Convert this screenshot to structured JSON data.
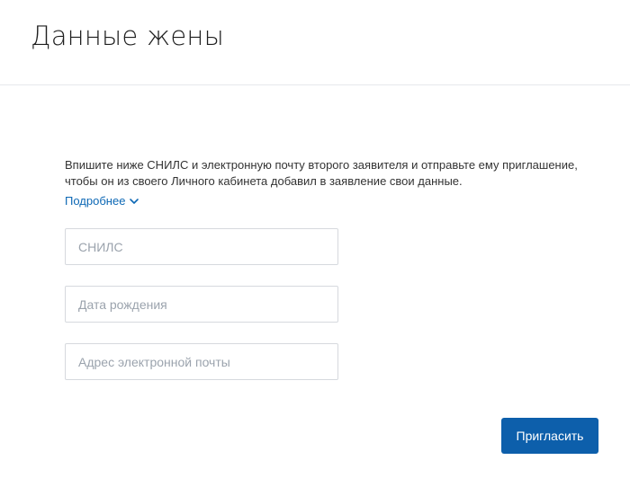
{
  "header": {
    "title": "Данные жены"
  },
  "main": {
    "description": "Впишите ниже СНИЛС и электронную почту второго заявителя и отправьте ему приглашение, чтобы он из своего Личного кабинета добавил в заявление свои данные.",
    "more_link_label": "Подробнее",
    "more_link_icon": "chevron-down-icon",
    "fields": {
      "snils": {
        "placeholder": "СНИЛС",
        "value": ""
      },
      "birth_date": {
        "placeholder": "Дата рождения",
        "value": ""
      },
      "email": {
        "placeholder": "Адрес электронной почты",
        "value": ""
      }
    },
    "invite_button_label": "Пригласить"
  },
  "colors": {
    "accent": "#0d5fab",
    "link": "#0d68b5",
    "border": "#d6d9de",
    "text": "#333333"
  }
}
